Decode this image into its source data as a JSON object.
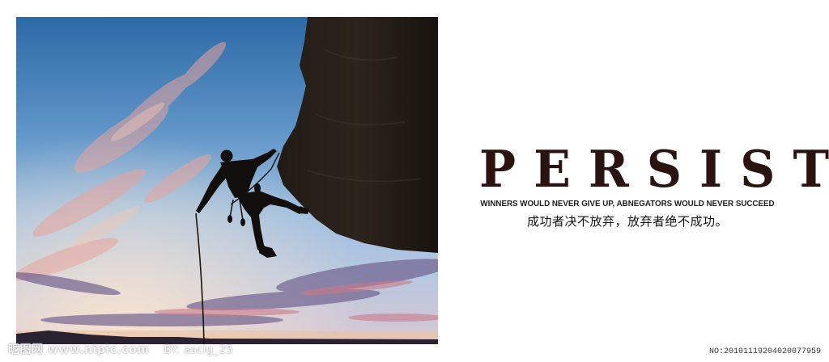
{
  "motto": {
    "headline": "PERSIST",
    "subline_en": "WINNERS WOULD NEVER GIVE UP, ABNEGATORS WOULD NEVER SUCCEED",
    "subline_zh": "成功者决不放弃，放弃者绝不成功。"
  },
  "watermark": {
    "site": "昵图网 www.nipic.com",
    "author": "BY: ascig_25",
    "serial": "NO:20101119204020077959"
  },
  "colors": {
    "headline": "#2b1410",
    "sky_top": "#2e6ea8",
    "cloud_pink": "#e9a39a",
    "rock": "#1b1612"
  }
}
